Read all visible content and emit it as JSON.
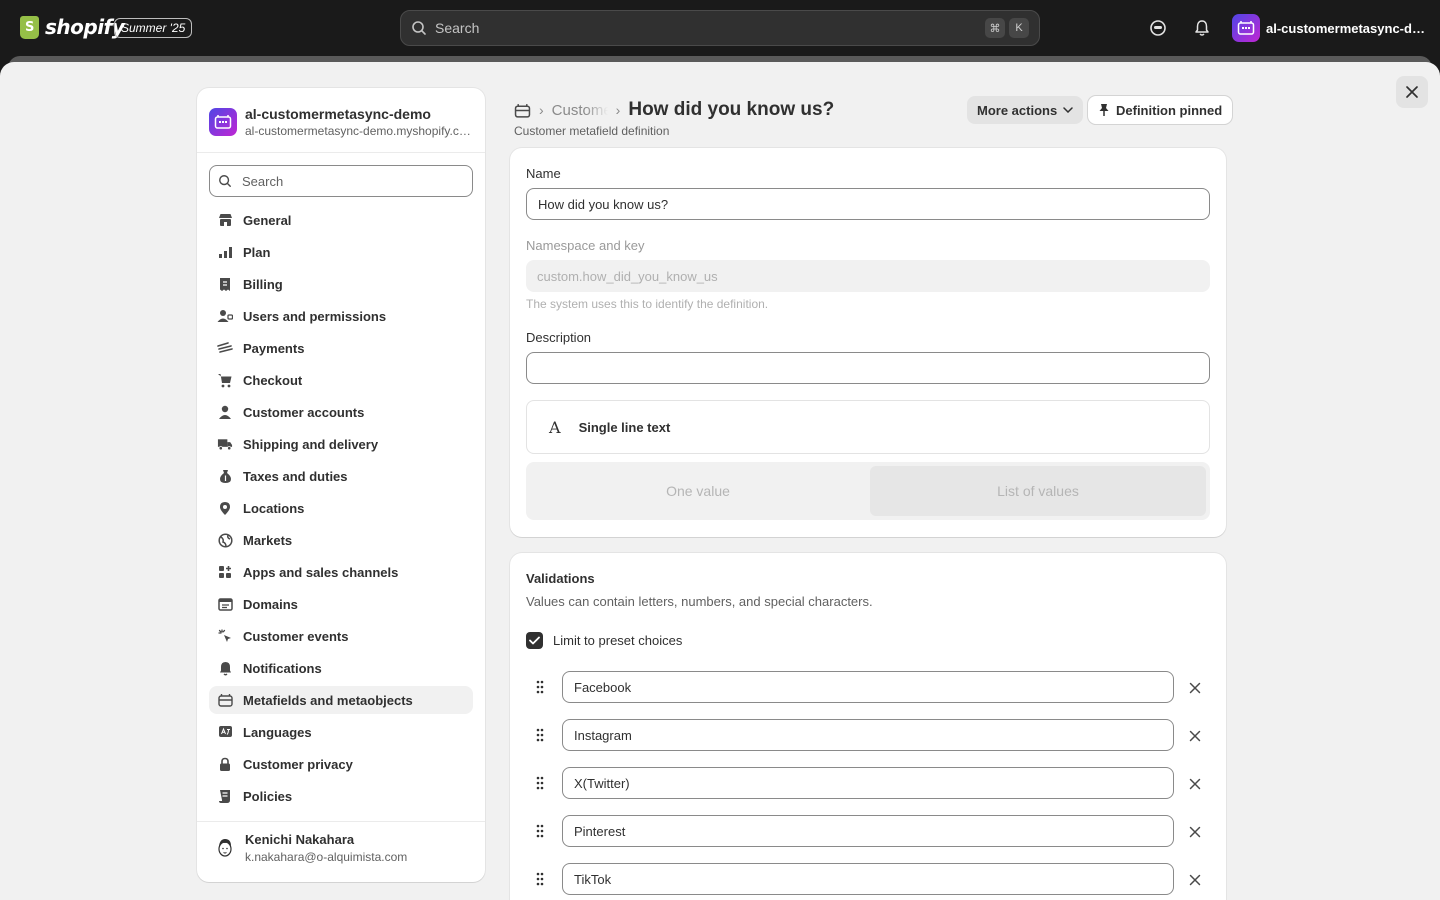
{
  "topbar": {
    "logo_text": "shopify",
    "edition": "Summer '25",
    "search_placeholder": "Search",
    "kbd_cmd": "⌘",
    "kbd_k": "K",
    "store_name": "al-customermetasync-demo"
  },
  "nav": {
    "store_name": "al-customermetasync-demo",
    "store_domain": "al-customermetasync-demo.myshopify.com",
    "search_placeholder": "Search",
    "items": [
      {
        "label": "General",
        "icon": "store-icon"
      },
      {
        "label": "Plan",
        "icon": "plan-icon"
      },
      {
        "label": "Billing",
        "icon": "billing-icon"
      },
      {
        "label": "Users and permissions",
        "icon": "users-icon"
      },
      {
        "label": "Payments",
        "icon": "payments-icon"
      },
      {
        "label": "Checkout",
        "icon": "cart-icon"
      },
      {
        "label": "Customer accounts",
        "icon": "person-icon"
      },
      {
        "label": "Shipping and delivery",
        "icon": "truck-icon"
      },
      {
        "label": "Taxes and duties",
        "icon": "tax-icon"
      },
      {
        "label": "Locations",
        "icon": "location-icon"
      },
      {
        "label": "Markets",
        "icon": "globe-icon"
      },
      {
        "label": "Apps and sales channels",
        "icon": "apps-icon"
      },
      {
        "label": "Domains",
        "icon": "domain-icon"
      },
      {
        "label": "Customer events",
        "icon": "cursor-icon"
      },
      {
        "label": "Notifications",
        "icon": "bell-icon"
      },
      {
        "label": "Metafields and metaobjects",
        "icon": "metafields-icon"
      },
      {
        "label": "Languages",
        "icon": "language-icon"
      },
      {
        "label": "Customer privacy",
        "icon": "lock-icon"
      },
      {
        "label": "Policies",
        "icon": "policy-icon"
      }
    ],
    "active_item": "Metafields and metaobjects",
    "user_name": "Kenichi Nakahara",
    "user_email": "k.nakahara@o-alquimista.com"
  },
  "header": {
    "crumb": "Customers",
    "title": "How did you know us?",
    "subtitle": "Customer metafield definition",
    "more_actions": "More actions",
    "pinned": "Definition pinned"
  },
  "definition": {
    "name_label": "Name",
    "name_value": "How did you know us?",
    "ns_label": "Namespace and key",
    "ns_value": "custom.how_did_you_know_us",
    "ns_help": "The system uses this to identify the definition.",
    "desc_label": "Description",
    "desc_value": "",
    "type_glyph": "A",
    "type_label": "Single line text",
    "seg_one": "One value",
    "seg_list": "List of values",
    "seg_selected": "List of values"
  },
  "validations": {
    "title": "Validations",
    "desc": "Values can contain letters, numbers, and special characters.",
    "limit_label": "Limit to preset choices",
    "limit_checked": true,
    "choices": [
      "Facebook",
      "Instagram",
      "X(Twitter)",
      "Pinterest",
      "TikTok"
    ]
  },
  "colors": {
    "topbar_bg": "#1a1a1a",
    "canvas_bg": "#f1f1f1",
    "card_bg": "#ffffff",
    "text_primary": "#303030",
    "text_secondary": "#616161",
    "accent_gradient_start": "#4f46e5",
    "accent_gradient_end": "#c026d3"
  }
}
